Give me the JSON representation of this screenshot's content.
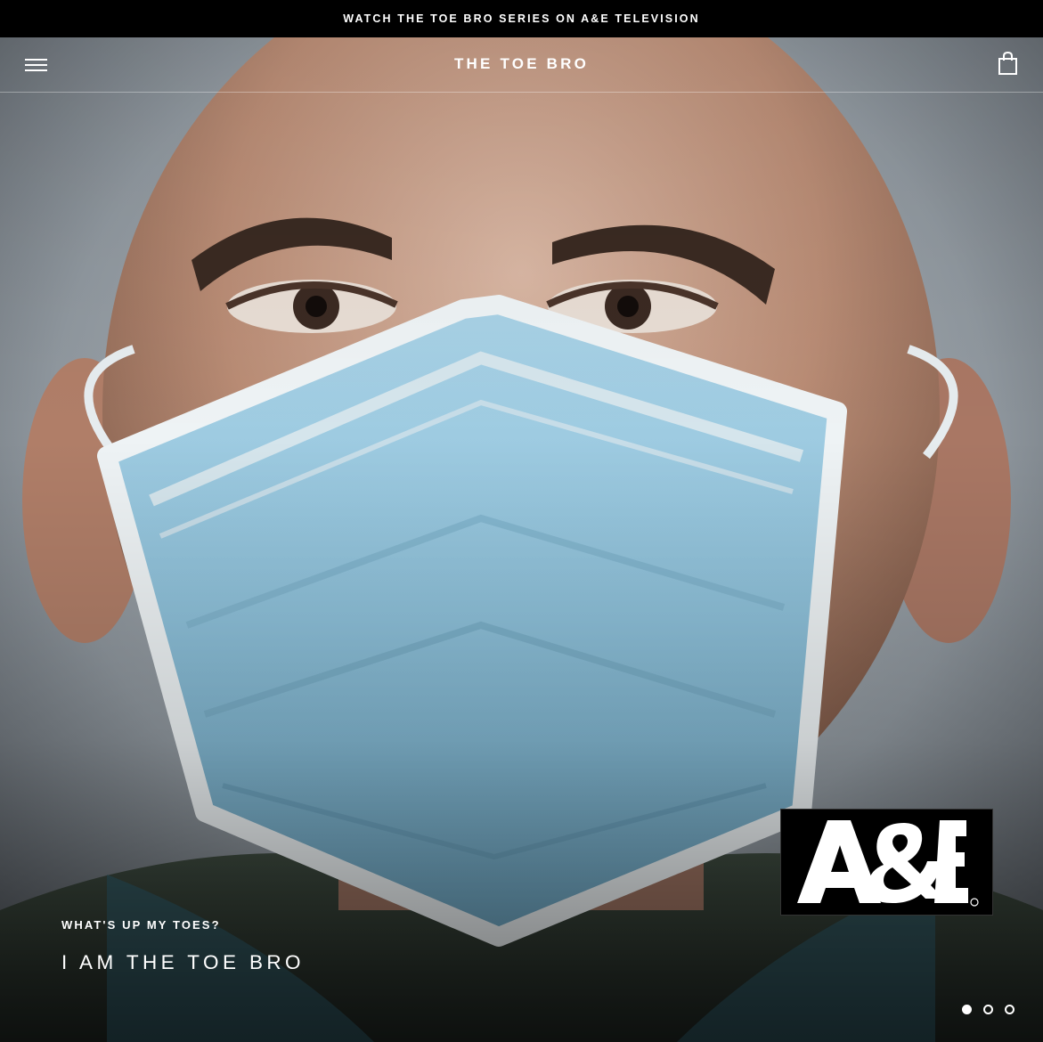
{
  "announcement": {
    "text": "WATCH THE TOE BRO SERIES ON A&E TELEVISION"
  },
  "header": {
    "logo": "THE TOE BRO",
    "menu_icon": "hamburger-menu-icon",
    "cart_icon": "shopping-bag-icon"
  },
  "hero": {
    "subtitle": "WHAT'S UP MY TOES?",
    "title": "I AM THE TOE BRO",
    "badge_logo": "A&E",
    "image": "man-wearing-surgical-mask-photo"
  },
  "slideshow": {
    "slide_count": 3,
    "active_index": 0
  },
  "colors": {
    "announcement_bg": "#000000",
    "text": "#ffffff",
    "mask_blue": "#8fc3dc"
  }
}
